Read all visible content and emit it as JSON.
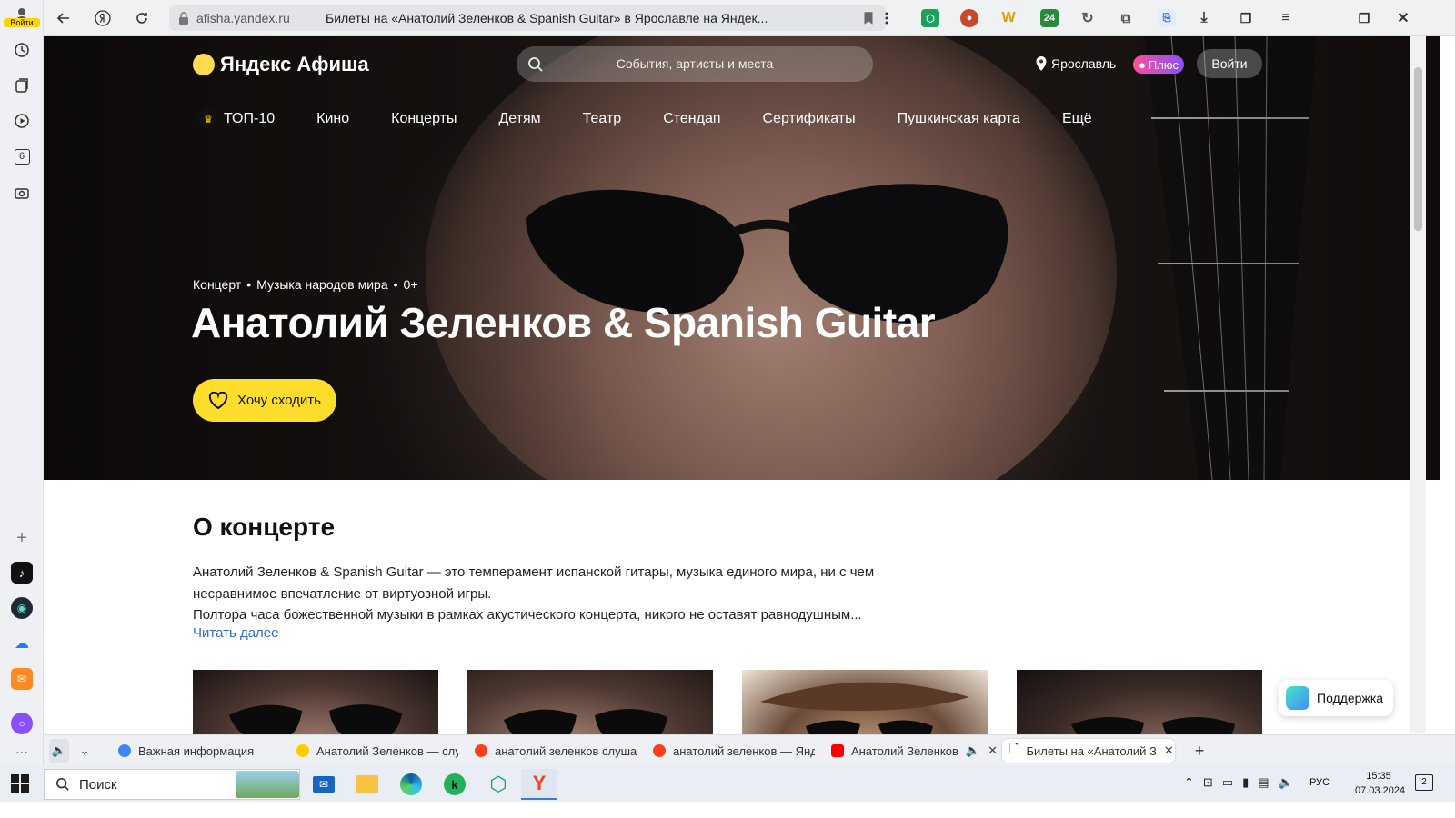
{
  "browser": {
    "url_domain": "afisha.yandex.ru",
    "page_title": "Билеты на «Анатолий Зеленков & Spanish Guitar» в Ярославле на Яндек...",
    "sidebar_login_label": "Войти",
    "sidebar_counter": "6"
  },
  "header": {
    "logo_text": "Яндекс Афиша",
    "search_placeholder": "События, артисты и места",
    "city": "Ярославль",
    "plus_label": "Плюс",
    "login_label": "Войти"
  },
  "nav": {
    "items": [
      "ТОП-10",
      "Кино",
      "Концерты",
      "Детям",
      "Театр",
      "Стендап",
      "Сертификаты",
      "Пушкинская карта",
      "Ещё"
    ]
  },
  "event": {
    "crumbs": [
      "Концерт",
      "Музыка народов мира",
      "0+"
    ],
    "title": "Анатолий Зеленков & Spanish Guitar",
    "want_button": "Хочу сходить"
  },
  "about": {
    "heading": "О концерте",
    "line1": "Анатолий Зеленков & Spanish Guitar — это темперамент испанской гитары, музыка единого мира, ни с чем",
    "line2": "несравнимое впечатление от виртуозной игры.",
    "line3": "Полтора часа божественной музыки в рамках акустического концерта, никого не оставят равнодушным...",
    "read_more": "Читать далее"
  },
  "support_label": "Поддержка",
  "tabs": [
    {
      "title": "Важная информация",
      "favicon_color": "#4285f4"
    },
    {
      "title": "Анатолий Зеленков — слу",
      "favicon_color": "#ffcc00"
    },
    {
      "title": "анатолий зеленков слуша",
      "favicon_color": "#fc3f1d"
    },
    {
      "title": "анатолий зеленков — Янд",
      "favicon_color": "#fc3f1d"
    },
    {
      "title": "Анатолий Зеленков",
      "favicon_color": "#ff0000"
    },
    {
      "title": "Билеты на «Анатолий З",
      "favicon_color": "#ffffff"
    }
  ],
  "taskbar": {
    "search_label": "Поиск",
    "lang": "РУС",
    "time": "15:35",
    "date": "07.03.2024",
    "notifications_count": "2"
  },
  "colors": {
    "accent_yellow": "#ffdd2d",
    "link_blue": "#2f6dd0"
  }
}
